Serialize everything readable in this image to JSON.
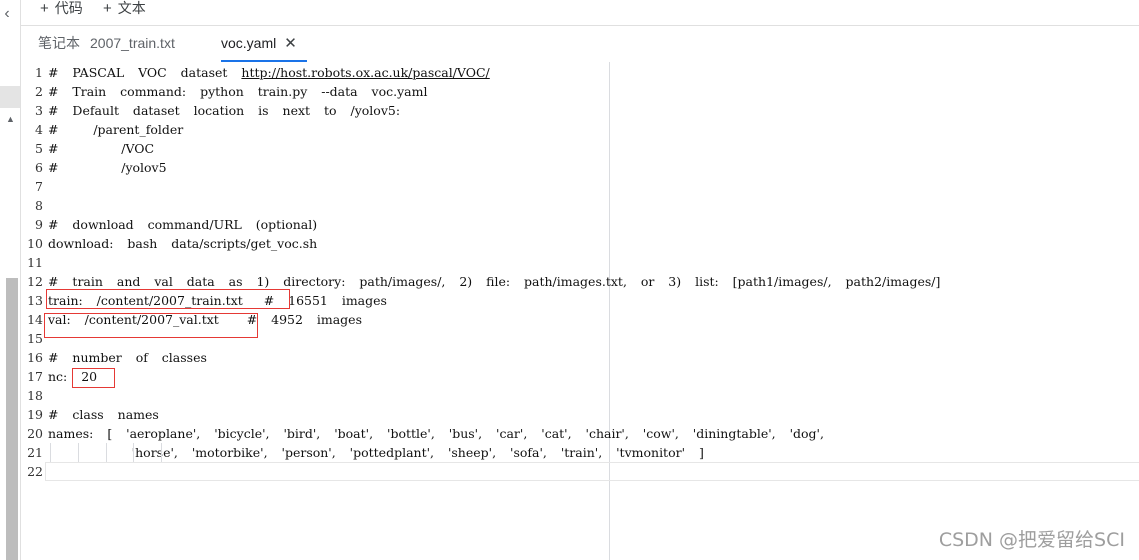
{
  "toolbar": {
    "add_code_label": "代码",
    "add_text_label": "文本"
  },
  "tabs": {
    "notebook_prefix": "笔记本",
    "notebook_file": "2007_train.txt",
    "active_file": "voc.yaml",
    "close_symbol": "✕"
  },
  "editor": {
    "lines": [
      {
        "n": "1",
        "text": "#  PASCAL  VOC  dataset  "
      },
      {
        "n": "2",
        "text": "#  Train  command:  python  train.py  --data  voc.yaml"
      },
      {
        "n": "3",
        "text": "#  Default  dataset  location  is  next  to  /yolov5:"
      },
      {
        "n": "4",
        "text": "#     /parent_folder"
      },
      {
        "n": "5",
        "text": "#         /VOC"
      },
      {
        "n": "6",
        "text": "#         /yolov5"
      },
      {
        "n": "7",
        "text": ""
      },
      {
        "n": "8",
        "text": ""
      },
      {
        "n": "9",
        "text": "#  download  command/URL  (optional)"
      },
      {
        "n": "10",
        "text": "download:  bash  data/scripts/get_voc.sh"
      },
      {
        "n": "11",
        "text": ""
      },
      {
        "n": "12",
        "text": "#  train  and  val  data  as  1)  directory:  path/images/,  2)  file:  path/images.txt,  or  3)  list:  [path1/images/,  path2/images/]"
      },
      {
        "n": "13",
        "text": "train:  /content/2007_train.txt   #  16551  images"
      },
      {
        "n": "14",
        "text": "val:  /content/2007_val.txt    #  4952  images"
      },
      {
        "n": "15",
        "text": ""
      },
      {
        "n": "16",
        "text": "#  number  of  classes"
      },
      {
        "n": "17",
        "text": "nc:  20"
      },
      {
        "n": "18",
        "text": ""
      },
      {
        "n": "19",
        "text": "#  class  names"
      },
      {
        "n": "20",
        "text": "names:  [  'aeroplane',  'bicycle',  'bird',  'boat',  'bottle',  'bus',  'car',  'cat',  'chair',  'cow',  'diningtable',  'dog',"
      },
      {
        "n": "21",
        "text": "            'horse',  'motorbike',  'person',  'pottedplant',  'sheep',  'sofa',  'train',  'tvmonitor'  ]"
      },
      {
        "n": "22",
        "text": ""
      }
    ],
    "line1_url": "http://host.robots.ox.ac.uk/pascal/VOC/"
  },
  "watermark": "CSDN @把爱留给SCI"
}
